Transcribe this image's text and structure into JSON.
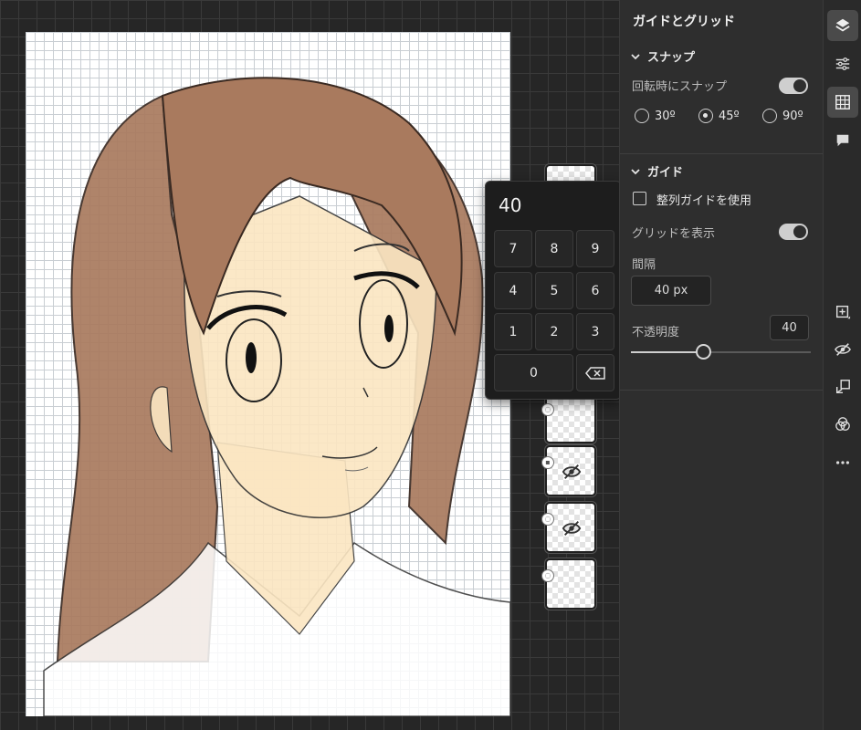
{
  "panel": {
    "title": "ガイドとグリッド",
    "snap": {
      "header": "スナップ",
      "rotate_snap_label": "回転時にスナップ",
      "rotate_snap_on": true,
      "angles": [
        "30º",
        "45º",
        "90º"
      ],
      "selected_angle": "45º"
    },
    "guides": {
      "header": "ガイド",
      "align_guides_label": "整列ガイドを使用",
      "align_guides_checked": false,
      "show_grid_label": "グリッドを表示",
      "show_grid_on": true,
      "spacing_label": "間隔",
      "spacing_value": "40 px",
      "opacity_label": "不透明度",
      "opacity_value": "40",
      "opacity_level": 0.4
    }
  },
  "numpad": {
    "display": "40",
    "keys": [
      "7",
      "8",
      "9",
      "4",
      "5",
      "6",
      "1",
      "2",
      "3",
      "0"
    ],
    "backspace_icon": "backspace-icon"
  },
  "rail": {
    "icons": [
      "layers-icon",
      "adjustments-icon",
      "grid-icon",
      "comment-icon",
      "add-layer-icon",
      "hide-icon",
      "import-icon",
      "blend-icon",
      "more-icon"
    ],
    "active": "grid-icon"
  },
  "layers": {
    "count": 6,
    "hidden_layers": [
      4,
      5
    ]
  },
  "colors": {
    "hair": "#a97a5e",
    "skin": "#fbe6c2",
    "panel_bg": "#2e2e2e",
    "accent_toggle": "#cfcfcf"
  }
}
